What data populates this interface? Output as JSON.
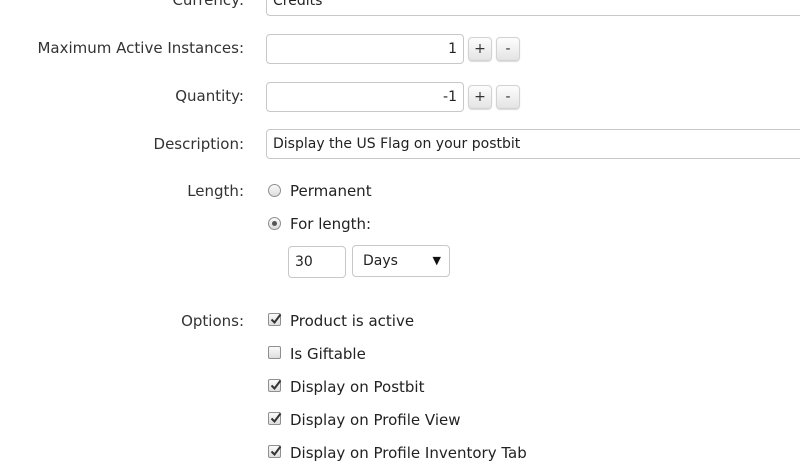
{
  "currency": {
    "label": "Currency:",
    "value": "Credits"
  },
  "max_active": {
    "label": "Maximum Active Instances:",
    "value": "1",
    "plus": "+",
    "minus": "-"
  },
  "quantity": {
    "label": "Quantity:",
    "value": "-1",
    "plus": "+",
    "minus": "-"
  },
  "description": {
    "label": "Description:",
    "value": "Display the US Flag on your postbit"
  },
  "length": {
    "label": "Length:",
    "options": [
      {
        "label": "Permanent",
        "selected": false
      },
      {
        "label": "For length:",
        "selected": true
      }
    ],
    "amount": "30",
    "unit": "Days"
  },
  "options": {
    "label": "Options:",
    "items": [
      {
        "label": "Product is active",
        "checked": true
      },
      {
        "label": "Is Giftable",
        "checked": false
      },
      {
        "label": "Display on Postbit",
        "checked": true
      },
      {
        "label": "Display on Profile View",
        "checked": true
      },
      {
        "label": "Display on Profile Inventory Tab",
        "checked": true
      }
    ]
  }
}
